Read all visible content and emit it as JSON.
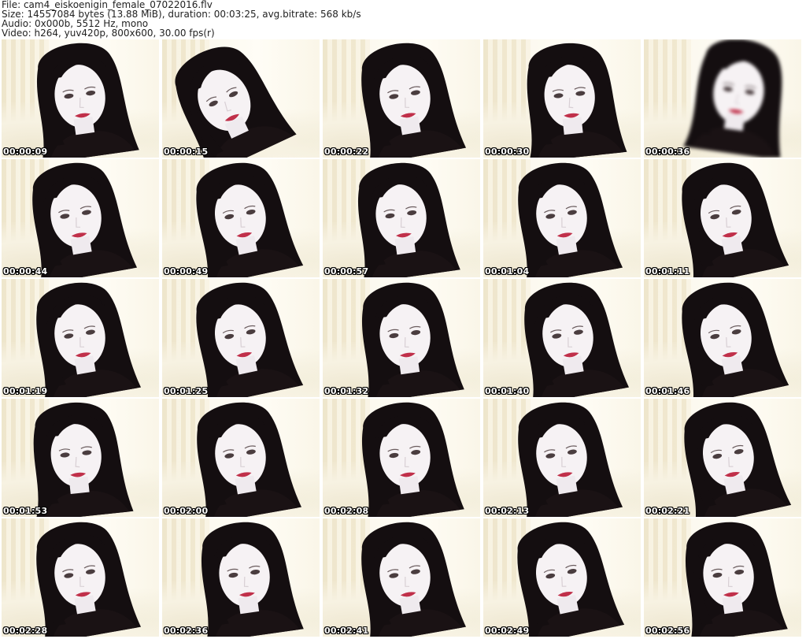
{
  "header": {
    "file_line": "File: cam4_eiskoenigin_female_07022016.flv",
    "size_line": "Size: 14557084 bytes (13.88 MiB), duration: 00:03:25, avg.bitrate: 568 kb/s",
    "audio_line": "Audio: 0x000b, 5512 Hz, mono",
    "video_line": "Video: h264, yuv420p, 800x600, 30.00 fps(r)"
  },
  "thumbnails": [
    {
      "timestamp": "00:00:09"
    },
    {
      "timestamp": "00:00:15"
    },
    {
      "timestamp": "00:00:22"
    },
    {
      "timestamp": "00:00:30"
    },
    {
      "timestamp": "00:00:36"
    },
    {
      "timestamp": "00:00:44"
    },
    {
      "timestamp": "00:00:49"
    },
    {
      "timestamp": "00:00:57"
    },
    {
      "timestamp": "00:01:04"
    },
    {
      "timestamp": "00:01:11"
    },
    {
      "timestamp": "00:01:19"
    },
    {
      "timestamp": "00:01:25"
    },
    {
      "timestamp": "00:01:32"
    },
    {
      "timestamp": "00:01:40"
    },
    {
      "timestamp": "00:01:46"
    },
    {
      "timestamp": "00:01:53"
    },
    {
      "timestamp": "00:02:00"
    },
    {
      "timestamp": "00:02:08"
    },
    {
      "timestamp": "00:02:13"
    },
    {
      "timestamp": "00:02:21"
    },
    {
      "timestamp": "00:02:28"
    },
    {
      "timestamp": "00:02:36"
    },
    {
      "timestamp": "00:02:41"
    },
    {
      "timestamp": "00:02:49"
    },
    {
      "timestamp": "00:02:56"
    }
  ]
}
